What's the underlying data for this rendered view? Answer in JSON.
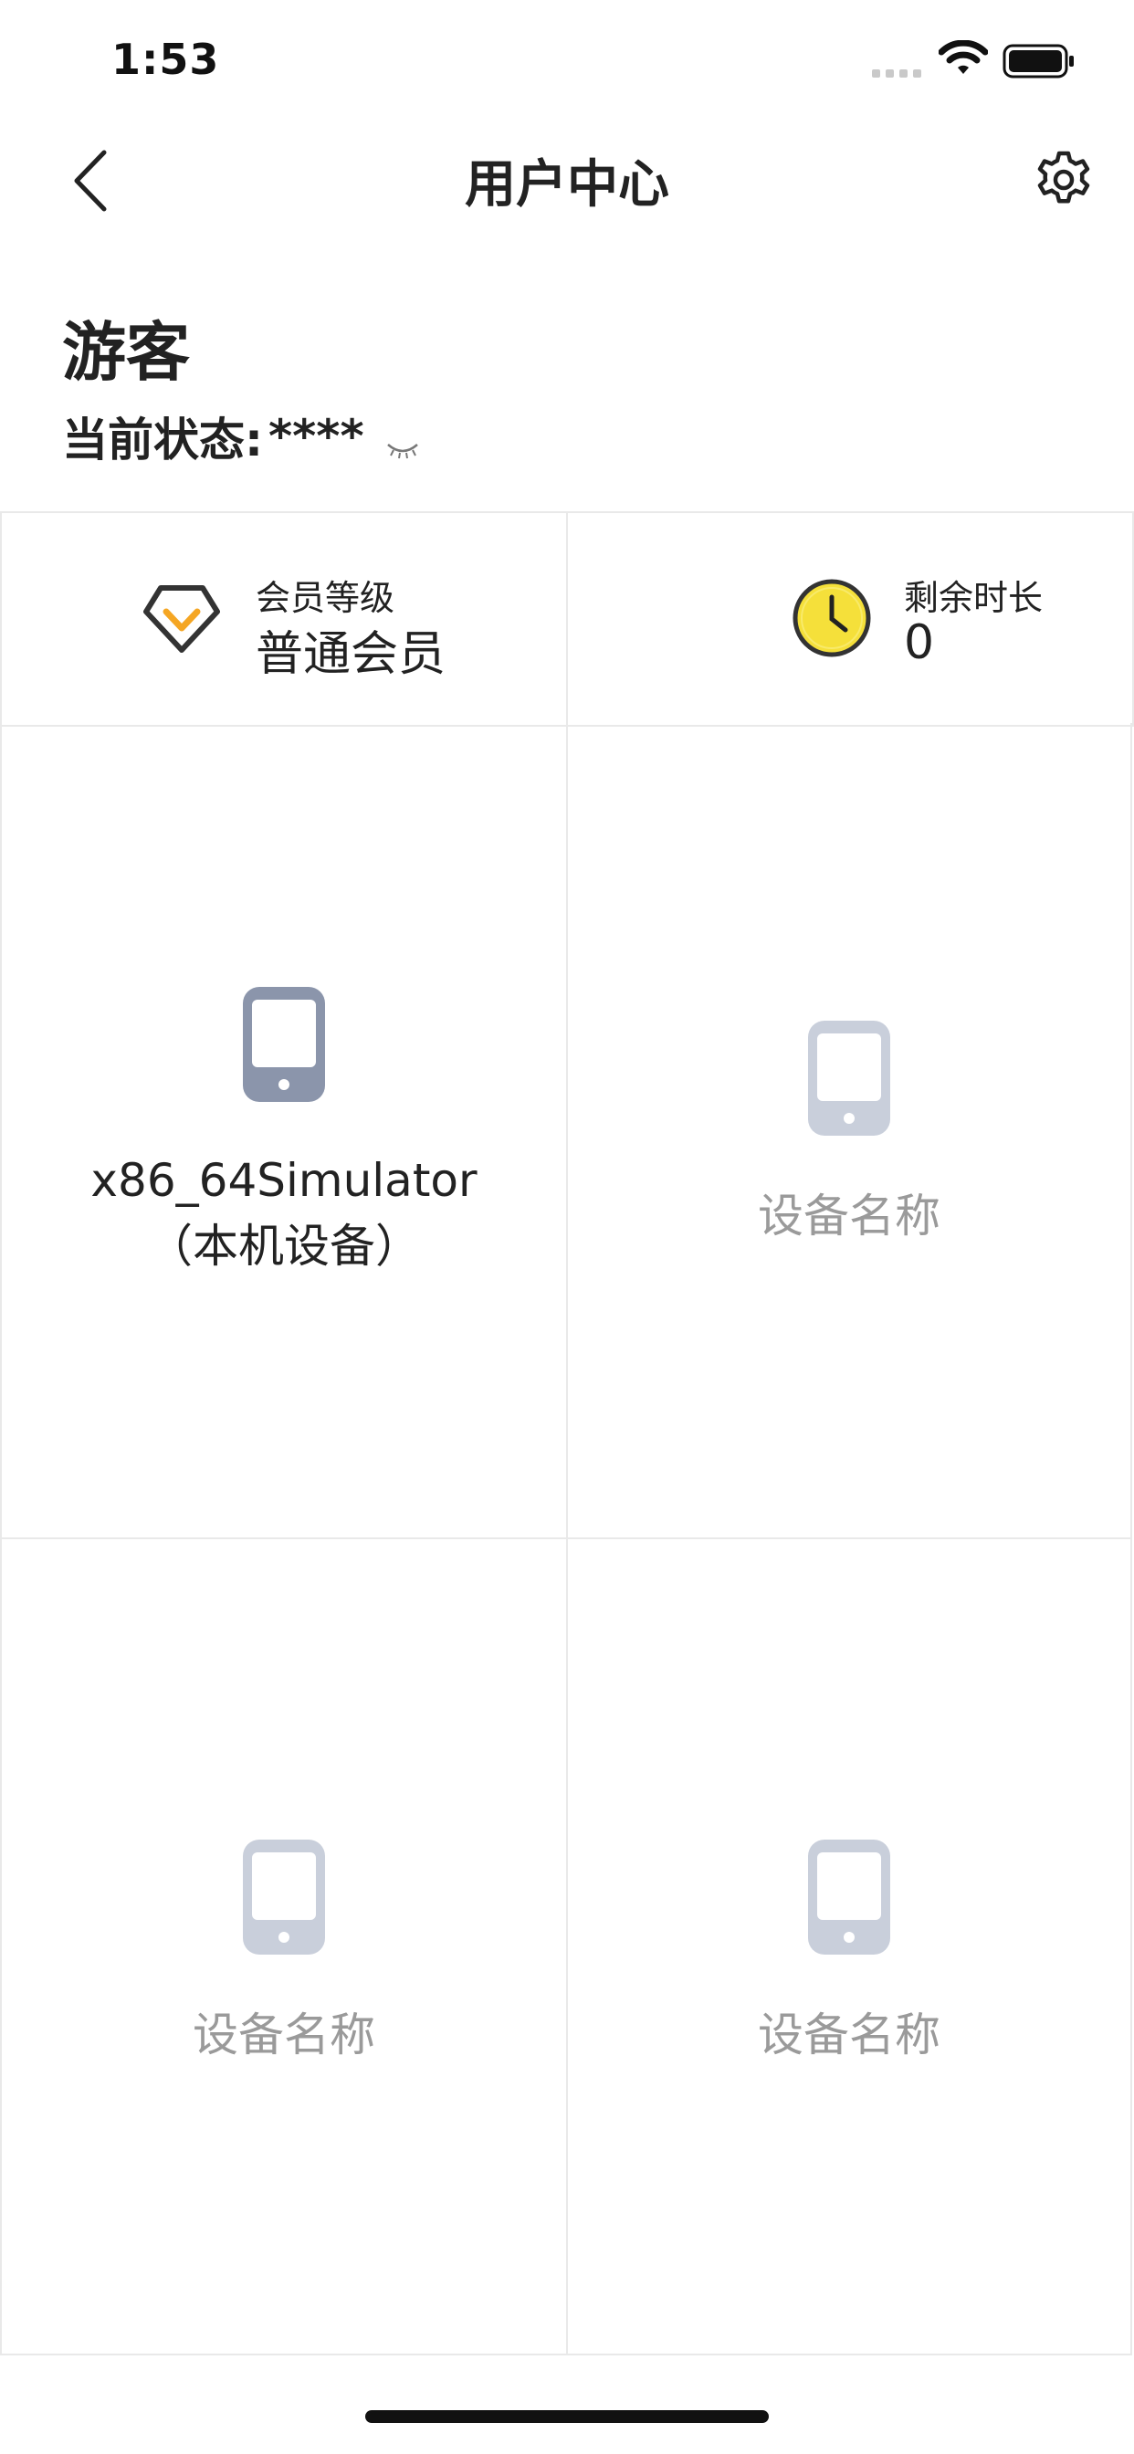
{
  "status_bar": {
    "time": "1:53"
  },
  "nav": {
    "title": "用户中心"
  },
  "user": {
    "name": "游客",
    "status_label": "当前状态:",
    "status_value": "****"
  },
  "stats": {
    "member_level_label": "会员等级",
    "member_level_value": "普通会员",
    "remaining_time_label": "剩余时长",
    "remaining_time_value": "0"
  },
  "devices": [
    {
      "name": "x86_64Simulator",
      "note": "（本机设备）",
      "active": true
    },
    {
      "name": "设备名称",
      "active": false
    },
    {
      "name": "设备名称",
      "active": false
    },
    {
      "name": "设备名称",
      "active": false
    }
  ],
  "colors": {
    "accent_yellow": "#f5c518",
    "diamond_orange": "#f5a623",
    "device_active": "#8b95ab",
    "device_inactive": "#c9cfdb",
    "placeholder_text": "#9a9a9a"
  },
  "icons": [
    "back-icon",
    "gear-icon",
    "eye-closed-icon",
    "diamond-icon",
    "clock-icon",
    "phone-icon"
  ]
}
